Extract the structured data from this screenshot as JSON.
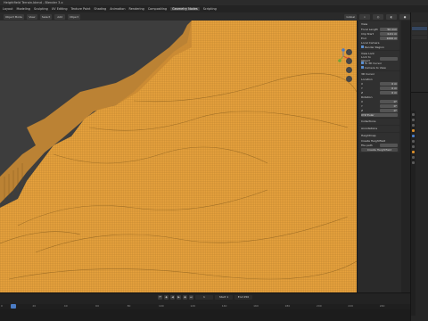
{
  "window": {
    "title": "Heightfield Terrain.blend - Blender 3.x"
  },
  "menu": [
    "Layout",
    "Modeling",
    "Sculpting",
    "UV Editing",
    "Texture Paint",
    "Shading",
    "Animation",
    "Rendering",
    "Compositing",
    "Geometry Nodes",
    "Scripting"
  ],
  "viewport_header": {
    "mode": "Object Mode",
    "view": "View",
    "select": "Select",
    "add": "Add",
    "object": "Object",
    "orientation": "Global"
  },
  "npanel": {
    "view_title": "View",
    "focal_label": "Focal Length",
    "focal_val": "50 mm",
    "clip_start_label": "Clip Start",
    "clip_start_val": "0.01 m",
    "clip_end_label": "End",
    "clip_end_val": "1000 m",
    "local_cam": "Local Camera",
    "render_region": "Render Region",
    "view_lock": "View Lock",
    "lock_to": "Lock to Object",
    "to_3d_cursor": "To 3D Cursor",
    "camera_to_view": "Camera to View",
    "cursor_title": "3D Cursor",
    "loc_label": "Location",
    "x_label": "X",
    "x_val": "0 m",
    "y_label": "Y",
    "y_val": "0 m",
    "z_label": "Z",
    "z_val": "0 m",
    "rot_label": "Rotation",
    "rx_val": "0°",
    "ry_val": "0°",
    "rz_val": "0°",
    "mode_label": "XYZ Euler",
    "collections": "Collections",
    "annotations": "Annotations",
    "heightmap": "Heightmap",
    "create_label": "Create Heightfield",
    "file_label": "File path",
    "create_btn": "Create Heightfield"
  },
  "timeline": {
    "frame_current": "1",
    "start_label": "Start",
    "start_val": "1",
    "end_label": "End",
    "end_val": "250",
    "ruler": [
      "0",
      "20",
      "40",
      "60",
      "80",
      "100",
      "120",
      "140",
      "160",
      "180",
      "200",
      "220",
      "240"
    ]
  },
  "colors": {
    "terrain": "#e7a23d",
    "accent_blue": "#4b7cc4",
    "accent_orange": "#d68c2a"
  }
}
